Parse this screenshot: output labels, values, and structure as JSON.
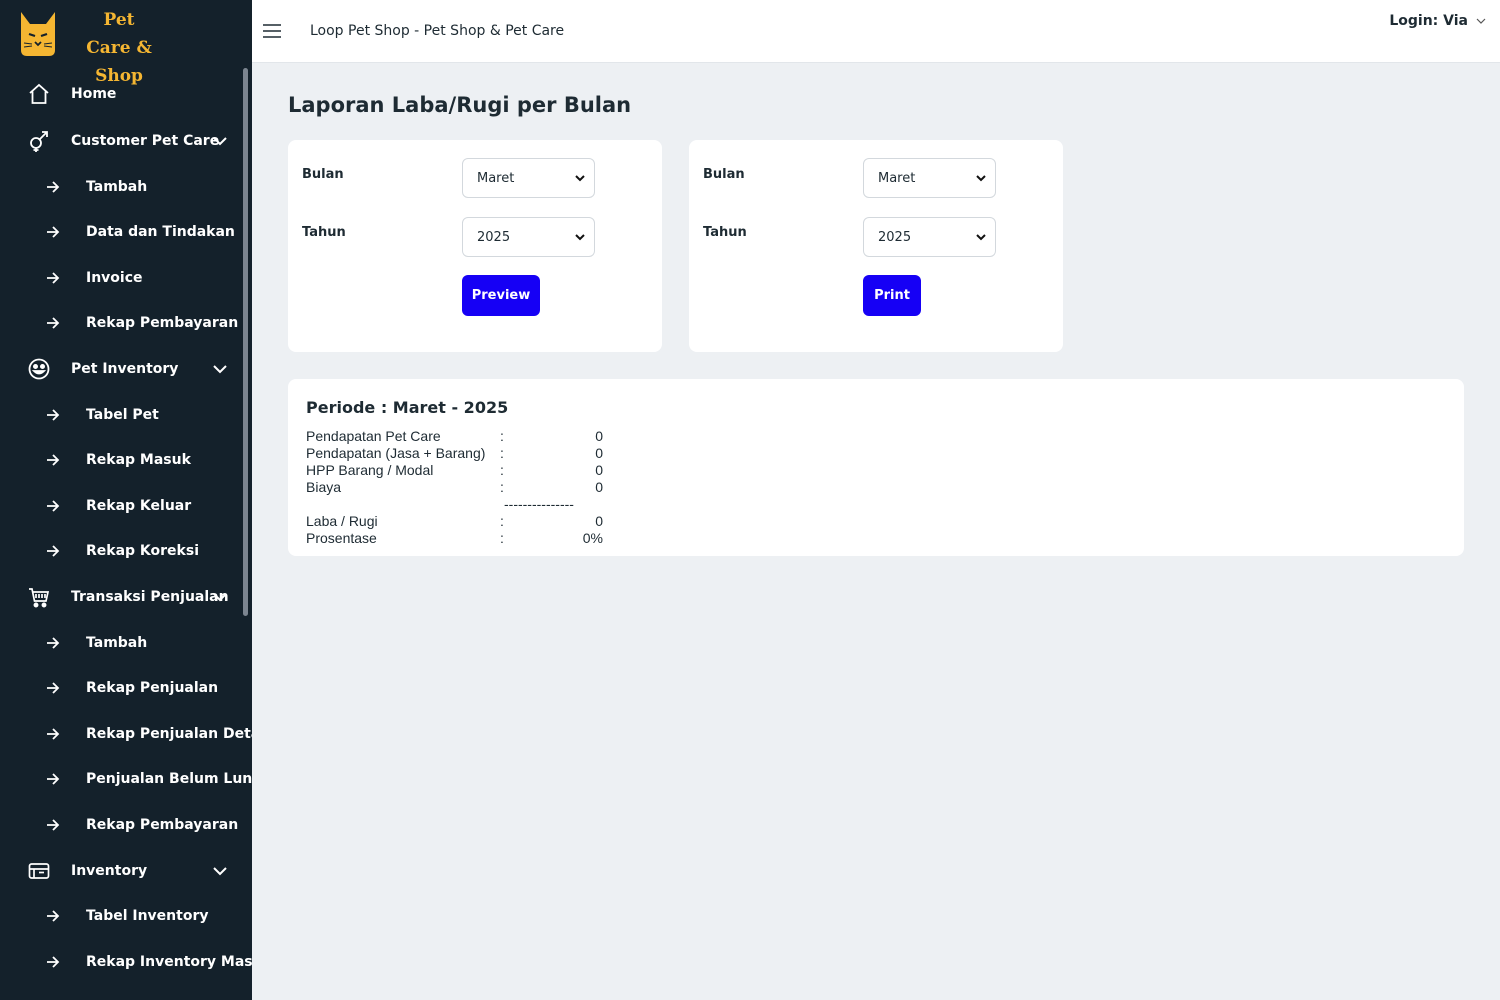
{
  "logo": {
    "line1": "Pet",
    "line2": "Care & Shop"
  },
  "sidebar": {
    "items": [
      {
        "label": "Home",
        "icon": "home-icon"
      },
      {
        "label": "Customer Pet Care",
        "icon": "pet-care-icon",
        "sub": [
          "Tambah",
          "Data dan Tindakan",
          "Invoice",
          "Rekap Pembayaran"
        ]
      },
      {
        "label": "Pet Inventory",
        "icon": "smiley-icon",
        "sub": [
          "Tabel Pet",
          "Rekap Masuk",
          "Rekap Keluar",
          "Rekap Koreksi"
        ]
      },
      {
        "label": "Transaksi Penjualan",
        "icon": "cart-icon",
        "sub": [
          "Tambah",
          "Rekap Penjualan",
          "Rekap Penjualan Detail",
          "Penjualan Belum Lunas",
          "Rekap Pembayaran"
        ]
      },
      {
        "label": "Inventory",
        "icon": "inventory-box-icon",
        "sub": [
          "Tabel Inventory",
          "Rekap Inventory Masuk"
        ]
      }
    ]
  },
  "header": {
    "title": "Loop Pet Shop - Pet Shop & Pet Care",
    "login": "Login: Via"
  },
  "page": {
    "title": "Laporan Laba/Rugi per Bulan"
  },
  "form_preview": {
    "bulan_label": "Bulan",
    "bulan_value": "Maret",
    "tahun_label": "Tahun",
    "tahun_value": "2025",
    "button": "Preview"
  },
  "form_print": {
    "bulan_label": "Bulan",
    "bulan_value": "Maret",
    "tahun_label": "Tahun",
    "tahun_value": "2025",
    "button": "Print"
  },
  "report": {
    "periode": "Periode : Maret - 2025",
    "rows": [
      {
        "label": "Pendapatan Pet Care",
        "value": "0"
      },
      {
        "label": "Pendapatan (Jasa + Barang)",
        "value": "0"
      },
      {
        "label": "HPP Barang / Modal",
        "value": "0"
      },
      {
        "label": "Biaya",
        "value": "0"
      }
    ],
    "separator": "---------------",
    "totals": [
      {
        "label": "Laba / Rugi",
        "value": "0"
      },
      {
        "label": "Prosentase",
        "value": "0%"
      }
    ]
  },
  "colors": {
    "sidebar_bg": "#14212b",
    "accent_button": "#1600f5",
    "logo_gold": "#f5b632",
    "page_bg": "#edf0f3"
  }
}
